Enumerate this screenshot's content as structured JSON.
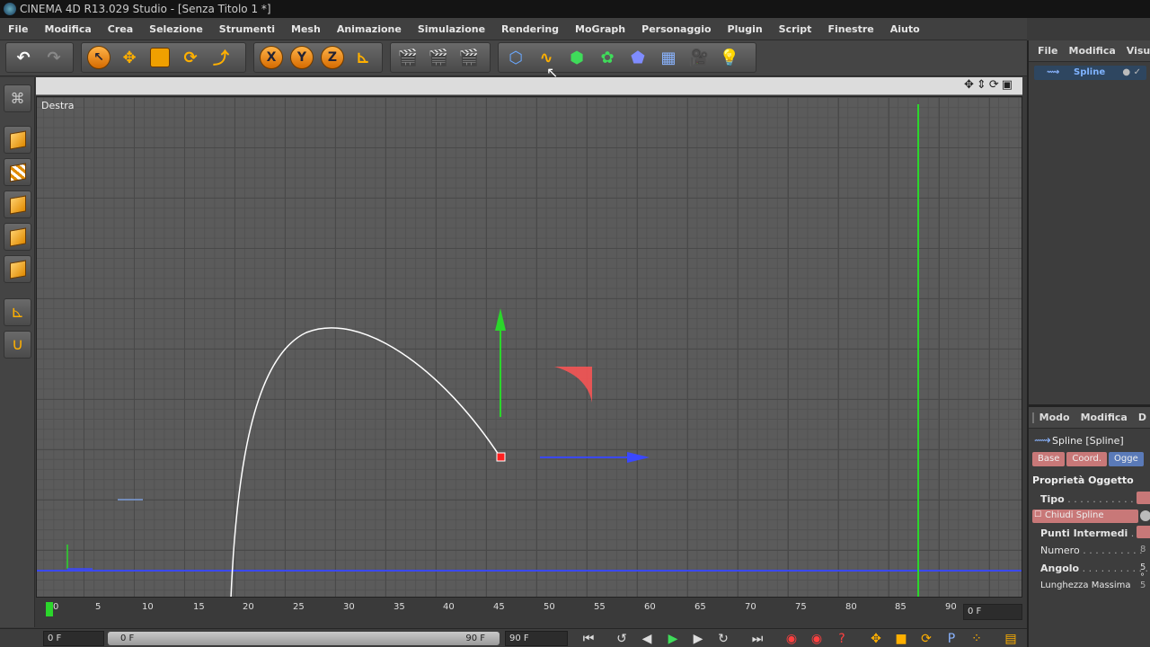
{
  "window": {
    "title": "CINEMA 4D R13.029 Studio - [Senza Titolo 1 *]"
  },
  "menu": [
    "File",
    "Modifica",
    "Crea",
    "Selezione",
    "Strumenti",
    "Mesh",
    "Animazione",
    "Simulazione",
    "Rendering",
    "MoGraph",
    "Personaggio",
    "Plugin",
    "Script",
    "Finestre",
    "Aiuto"
  ],
  "toolbar": {
    "x_label": "X",
    "y_label": "Y",
    "z_label": "Z"
  },
  "viewport": {
    "name": "Destra",
    "accent_x": "#2a3cff",
    "accent_y": "#2bd62b",
    "spline_color": "#ffffff"
  },
  "timeline": {
    "ticks": [
      "0",
      "5",
      "10",
      "15",
      "20",
      "25",
      "30",
      "35",
      "40",
      "45",
      "50",
      "55",
      "60",
      "65",
      "70",
      "75",
      "80",
      "85",
      "90"
    ],
    "frame_field_right": "0 F",
    "start_field": "0 F",
    "slider_start": "0 F",
    "slider_end": "90 F",
    "end_field": "90 F"
  },
  "object_manager": {
    "menu": [
      "File",
      "Modifica",
      "Visu"
    ],
    "item": "Spline"
  },
  "attribute_manager": {
    "menu": [
      "Modo",
      "Modifica",
      "D"
    ],
    "object_title": "Spline [Spline]",
    "tabs": [
      "Base",
      "Coord.",
      "Ogge"
    ],
    "section": "Proprietà Oggetto",
    "rows": [
      {
        "label": "Tipo",
        "dots": ". . . . . . . . . . . . ."
      },
      {
        "label": "Chiudi Spline",
        "dots": ""
      },
      {
        "label": "Punti Intermedi",
        "dots": ". . ."
      },
      {
        "label": "Numero",
        "dots": ". . . . . . . . . .",
        "value": "8"
      },
      {
        "label": "Angolo",
        "dots": ". . . . . . . . . . .",
        "value": "5 °"
      },
      {
        "label": "Lunghezza Massima",
        "dots": "",
        "value": "5"
      }
    ]
  }
}
